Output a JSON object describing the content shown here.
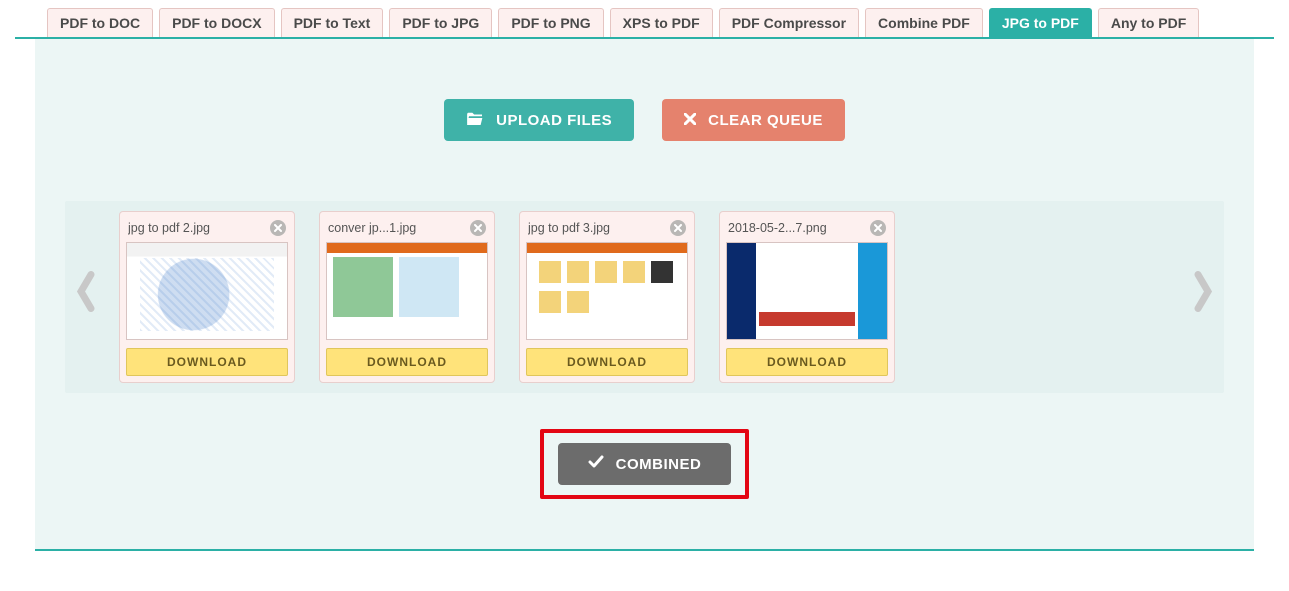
{
  "tabs": [
    {
      "label": "PDF to DOC",
      "active": false
    },
    {
      "label": "PDF to DOCX",
      "active": false
    },
    {
      "label": "PDF to Text",
      "active": false
    },
    {
      "label": "PDF to JPG",
      "active": false
    },
    {
      "label": "PDF to PNG",
      "active": false
    },
    {
      "label": "XPS to PDF",
      "active": false
    },
    {
      "label": "PDF Compressor",
      "active": false
    },
    {
      "label": "Combine PDF",
      "active": false
    },
    {
      "label": "JPG to PDF",
      "active": true
    },
    {
      "label": "Any to PDF",
      "active": false
    }
  ],
  "actions": {
    "upload": "UPLOAD FILES",
    "clear": "CLEAR QUEUE",
    "combined": "COMBINED"
  },
  "queue": [
    {
      "filename": "jpg to pdf 2.jpg",
      "download": "DOWNLOAD",
      "thumb": "t1"
    },
    {
      "filename": "conver jp...1.jpg",
      "download": "DOWNLOAD",
      "thumb": "t2"
    },
    {
      "filename": "jpg to pdf 3.jpg",
      "download": "DOWNLOAD",
      "thumb": "t3"
    },
    {
      "filename": "2018-05-2...7.png",
      "download": "DOWNLOAD",
      "thumb": "t4"
    }
  ]
}
